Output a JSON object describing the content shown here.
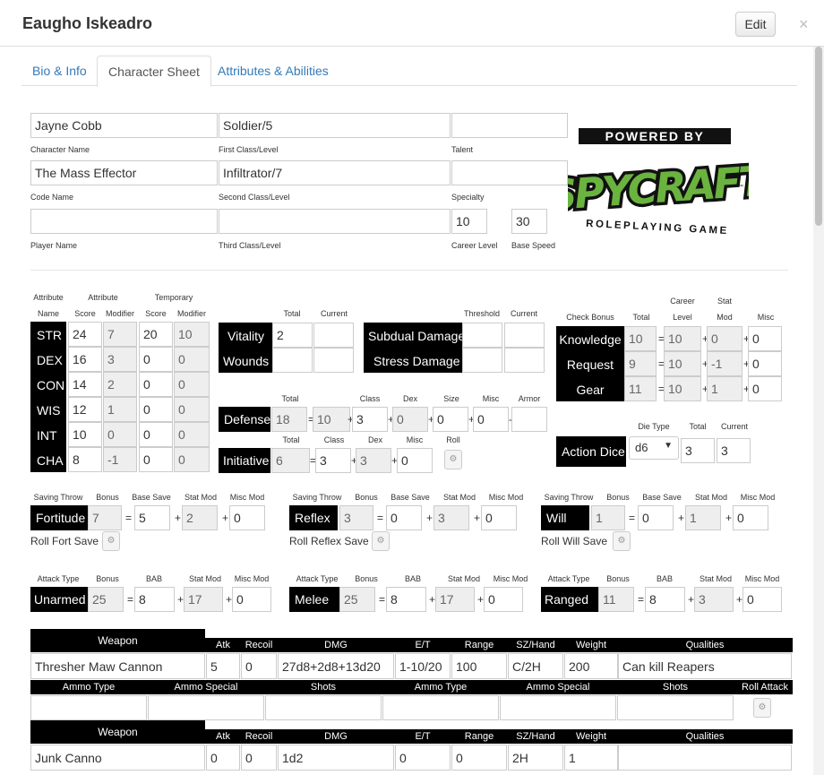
{
  "window": {
    "title": "Eaugho Iskeadro",
    "edit_label": "Edit",
    "close_glyph": "×"
  },
  "tabs": [
    {
      "label": "Bio & Info"
    },
    {
      "label": "Character Sheet"
    },
    {
      "label": "Attributes & Abilities"
    }
  ],
  "identity": {
    "character_name": {
      "value": "Jayne Cobb",
      "label": "Character Name"
    },
    "first_class": {
      "value": "Soldier/5",
      "label": "First Class/Level"
    },
    "talent": {
      "value": "",
      "label": "Talent"
    },
    "code_name": {
      "value": "The Mass Effector",
      "label": "Code Name"
    },
    "second_class": {
      "value": "Infiltrator/7",
      "label": "Second Class/Level"
    },
    "specialty": {
      "value": "",
      "label": "Specialty"
    },
    "player_name": {
      "value": "",
      "label": "Player Name"
    },
    "third_class": {
      "value": "",
      "label": "Third Class/Level"
    },
    "career_level": {
      "value": "10",
      "label": "Career Level"
    },
    "base_speed": {
      "value": "30",
      "label": "Base Speed"
    }
  },
  "logo": {
    "top": "POWERED BY",
    "brand": "SPYCRAFT",
    "tm": "™",
    "bottom": "ROLEPLAYING GAME"
  },
  "attributes": {
    "headers": {
      "h1a": "Attribute",
      "h1b": "Name",
      "h2": "Attribute",
      "h2a": "Score",
      "h2b": "Modifier",
      "h3": "Temporary",
      "h3a": "Score",
      "h3b": "Modifier"
    },
    "rows": [
      {
        "name": "STR",
        "score": "24",
        "mod": "7",
        "tscore": "20",
        "tmod": "10"
      },
      {
        "name": "DEX",
        "score": "16",
        "mod": "3",
        "tscore": "0",
        "tmod": "0"
      },
      {
        "name": "CON",
        "score": "14",
        "mod": "2",
        "tscore": "0",
        "tmod": "0"
      },
      {
        "name": "WIS",
        "score": "12",
        "mod": "1",
        "tscore": "0",
        "tmod": "0"
      },
      {
        "name": "INT",
        "score": "10",
        "mod": "0",
        "tscore": "0",
        "tmod": "0"
      },
      {
        "name": "CHA",
        "score": "8",
        "mod": "-1",
        "tscore": "0",
        "tmod": "0"
      }
    ]
  },
  "vitality": {
    "total_h": "Total",
    "current_h": "Current",
    "vitality_label": "Vitality",
    "vitality_total": "2",
    "vitality_current": "",
    "wounds_label": "Wounds",
    "wounds_total": "",
    "wounds_current": ""
  },
  "damage": {
    "threshold_h": "Threshold",
    "current_h": "Current",
    "subdual_label": "Subdual Damage",
    "stress_label": "Stress Damage"
  },
  "checks": {
    "h_check": "Check Bonus",
    "h_total": "Total",
    "h_career": "Career",
    "h_level": "Level",
    "h_stat": "Stat",
    "h_mod": "Mod",
    "h_misc": "Misc",
    "rows": [
      {
        "name": "Knowledge",
        "total": "10",
        "career": "10",
        "stat": "0",
        "misc": "0"
      },
      {
        "name": "Request",
        "total": "9",
        "career": "10",
        "stat": "-1",
        "misc": "0"
      },
      {
        "name": "Gear",
        "total": "11",
        "career": "10",
        "stat": "1",
        "misc": "0"
      }
    ]
  },
  "defense": {
    "h_total": "Total",
    "h_class": "Class",
    "h_dex": "Dex",
    "h_size": "Size",
    "h_misc": "Misc",
    "h_armor": "Armor",
    "label": "Defense",
    "total": "18",
    "class": "10",
    "dex": "3",
    "size": "0",
    "misc": "0",
    "armor": "0"
  },
  "initiative": {
    "h_total": "Total",
    "h_class": "Class",
    "h_dex": "Dex",
    "h_misc": "Misc",
    "h_roll": "Roll",
    "label": "Initiative",
    "total": "6",
    "class": "3",
    "dex": "3",
    "misc": "0"
  },
  "action_dice": {
    "h_type": "Die Type",
    "h_total": "Total",
    "h_current": "Current",
    "label": "Action Dice",
    "die": "d6",
    "total": "3",
    "current": "3"
  },
  "saves": {
    "h_throw": "Saving Throw",
    "h_bonus": "Bonus",
    "h_base": "Base Save",
    "h_stat": "Stat Mod",
    "h_misc": "Misc Mod",
    "items": [
      {
        "name": "Fortitude",
        "bonus": "7",
        "base": "5",
        "stat": "2",
        "misc": "0",
        "roll": "Roll Fort Save"
      },
      {
        "name": "Reflex",
        "bonus": "3",
        "base": "0",
        "stat": "3",
        "misc": "0",
        "roll": "Roll Reflex Save"
      },
      {
        "name": "Will",
        "bonus": "1",
        "base": "0",
        "stat": "1",
        "misc": "0",
        "roll": "Roll Will Save"
      }
    ]
  },
  "attacks": {
    "h_type": "Attack Type",
    "h_bonus": "Bonus",
    "h_bab": "BAB",
    "h_stat": "Stat Mod",
    "h_misc": "Misc Mod",
    "items": [
      {
        "name": "Unarmed",
        "bonus": "25",
        "bab": "8",
        "stat": "17",
        "misc": "0"
      },
      {
        "name": "Melee",
        "bonus": "25",
        "bab": "8",
        "stat": "17",
        "misc": "0"
      },
      {
        "name": "Ranged",
        "bonus": "11",
        "bab": "8",
        "stat": "3",
        "misc": "0"
      }
    ]
  },
  "weapons": {
    "headers": {
      "weapon": "Weapon",
      "atk": "Atk",
      "recoil": "Recoil",
      "dmg": "DMG",
      "et": "E/T",
      "range": "Range",
      "sz": "SZ/Hand",
      "weight": "Weight",
      "qualities": "Qualities"
    },
    "ammo_headers": {
      "type": "Ammo Type",
      "special": "Ammo Special",
      "shots": "Shots",
      "roll": "Roll Attack"
    },
    "items": [
      {
        "name": "Thresher Maw Cannon",
        "atk": "5",
        "recoil": "0",
        "dmg": "27d8+2d8+13d20",
        "et": "1-10/20",
        "range": "100",
        "sz": "C/2H",
        "weight": "200",
        "qualities": "Can kill Reapers"
      },
      {
        "name": "Junk Canno",
        "atk": "0",
        "recoil": "0",
        "dmg": "1d2",
        "et": "0",
        "range": "0",
        "sz": "2H",
        "weight": "1",
        "qualities": ""
      }
    ]
  }
}
